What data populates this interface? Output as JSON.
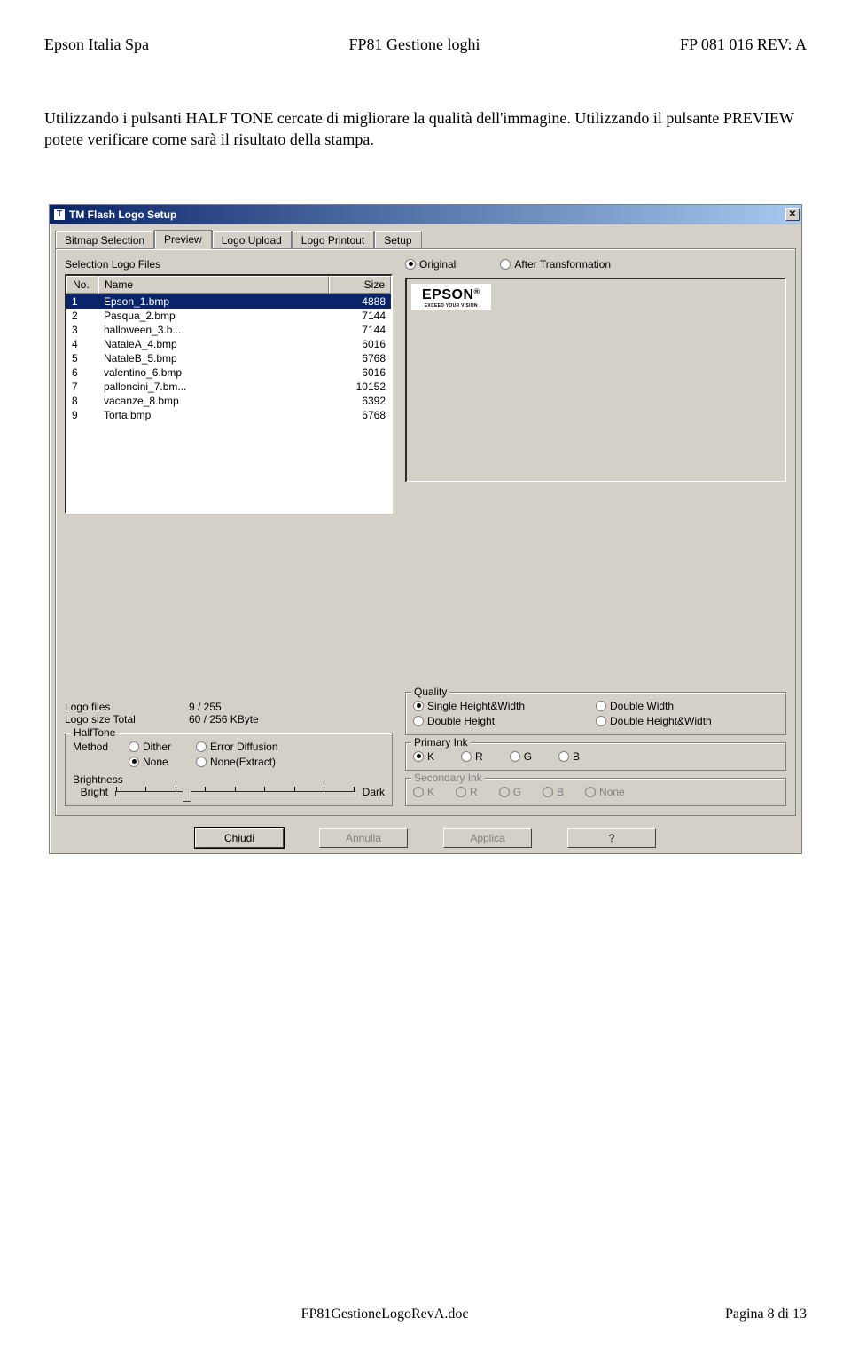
{
  "header": {
    "left": "Epson Italia Spa",
    "center": "FP81 Gestione loghi",
    "right": "FP 081 016 REV: A"
  },
  "body_text": "Utilizzando i pulsanti HALF TONE cercate di migliorare la qualità dell'immagine. Utilizzando  il pulsante PREVIEW potete verificare come sarà il risultato della stampa.",
  "window": {
    "title": "TM Flash Logo Setup",
    "tabs": [
      "Bitmap Selection",
      "Preview",
      "Logo Upload",
      "Logo Printout",
      "Setup"
    ],
    "active_tab": 1,
    "list_caption": "Selection Logo Files",
    "columns": {
      "no": "No.",
      "name": "Name",
      "size": "Size"
    },
    "files": [
      {
        "no": "1",
        "name": "Epson_1.bmp",
        "size": "4888",
        "sel": true
      },
      {
        "no": "2",
        "name": "Pasqua_2.bmp",
        "size": "7144"
      },
      {
        "no": "3",
        "name": "halloween_3.b...",
        "size": "7144"
      },
      {
        "no": "4",
        "name": "NataleA_4.bmp",
        "size": "6016"
      },
      {
        "no": "5",
        "name": "NataleB_5.bmp",
        "size": "6768"
      },
      {
        "no": "6",
        "name": "valentino_6.bmp",
        "size": "6016"
      },
      {
        "no": "7",
        "name": "palloncini_7.bm...",
        "size": "10152"
      },
      {
        "no": "8",
        "name": "vacanze_8.bmp",
        "size": "6392"
      },
      {
        "no": "9",
        "name": "Torta.bmp",
        "size": "6768"
      }
    ],
    "counts": {
      "files_label": "Logo files",
      "files_value": "9 / 255",
      "size_label": "Logo size Total",
      "size_value": "60 / 256 KByte"
    },
    "halftone": {
      "legend": "HalfTone",
      "method_label": "Method",
      "methods": [
        "Dither",
        "Error Diffusion",
        "None",
        "None(Extract)"
      ],
      "method_selected": 2,
      "brightness_label": "Brightness",
      "bright": "Bright",
      "dark": "Dark"
    },
    "viewmode": {
      "original": "Original",
      "after": "After Transformation",
      "selected": 0
    },
    "logo": {
      "brand": "EPSON",
      "reg": "®",
      "tag": "EXCEED YOUR VISION"
    },
    "quality": {
      "legend": "Quality",
      "opts": [
        "Single Height&Width",
        "Double Width",
        "Double Height",
        "Double Height&Width"
      ],
      "selected": 0
    },
    "primary": {
      "legend": "Primary Ink",
      "opts": [
        "K",
        "R",
        "G",
        "B"
      ],
      "selected": 0
    },
    "secondary": {
      "legend": "Secondary Ink",
      "opts": [
        "K",
        "R",
        "G",
        "B",
        "None"
      ]
    },
    "buttons": {
      "close": "Chiudi",
      "cancel": "Annulla",
      "apply": "Applica",
      "help": "?"
    }
  },
  "footer": {
    "file": "FP81GestioneLogoRevA.doc",
    "page": "Pagina 8 di 13"
  }
}
